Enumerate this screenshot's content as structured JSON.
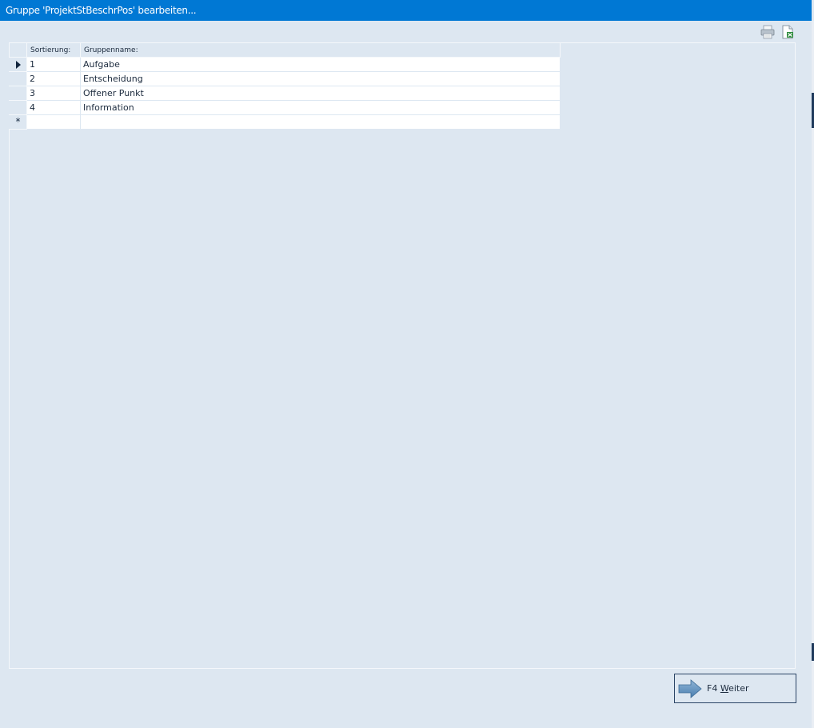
{
  "window": {
    "title": "Gruppe 'ProjektStBeschrPos' bearbeiten..."
  },
  "toolbar": {
    "print_icon": "printer-icon",
    "export_icon": "excel-export-icon"
  },
  "grid": {
    "columns": [
      "Sortierung:",
      "Gruppenname:"
    ],
    "rows": [
      {
        "sort": "1",
        "name": "Aufgabe",
        "selected": true
      },
      {
        "sort": "2",
        "name": "Entscheidung"
      },
      {
        "sort": "3",
        "name": "Offener Punkt"
      },
      {
        "sort": "4",
        "name": "Information"
      }
    ],
    "new_row_marker": "*"
  },
  "footer": {
    "next_key": "F4",
    "next_accel": "W",
    "next_rest": "eiter",
    "next_icon": "arrow-right-icon"
  },
  "colors": {
    "titlebar": "#0078d4",
    "background": "#dde7f1",
    "text": "#1b2a3d"
  }
}
